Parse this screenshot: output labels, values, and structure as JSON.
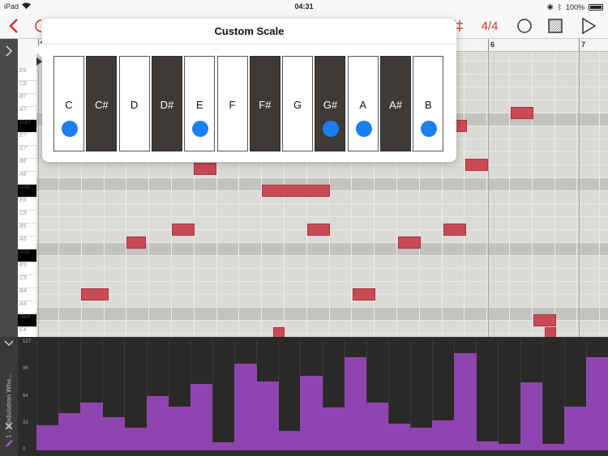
{
  "status": {
    "device": "iPad",
    "time": "04:31",
    "battery": "100%"
  },
  "toolbar": {
    "time_signature": "4/4",
    "accent_color": "#c8372d"
  },
  "ruler": {
    "visible_bars": [
      "1",
      "6",
      "7"
    ]
  },
  "keyboard": {
    "labels": [
      "E8",
      "C8",
      "B7",
      "A7",
      "G#7",
      "E7",
      "C7",
      "B6",
      "A6",
      "G#6",
      "E6",
      "C6",
      "B5",
      "A5",
      "G#5",
      "E5",
      "C5",
      "B4",
      "A4",
      "G#4",
      "E4"
    ]
  },
  "popover": {
    "title": "Custom Scale",
    "keys": [
      {
        "label": "C",
        "type": "white",
        "selected": true
      },
      {
        "label": "C#",
        "type": "black",
        "selected": false
      },
      {
        "label": "D",
        "type": "white",
        "selected": false
      },
      {
        "label": "D#",
        "type": "black",
        "selected": false
      },
      {
        "label": "E",
        "type": "white",
        "selected": true
      },
      {
        "label": "F",
        "type": "white",
        "selected": false
      },
      {
        "label": "F#",
        "type": "black",
        "selected": false
      },
      {
        "label": "G",
        "type": "white",
        "selected": false
      },
      {
        "label": "G#",
        "type": "black",
        "selected": true
      },
      {
        "label": "A",
        "type": "white",
        "selected": true
      },
      {
        "label": "A#",
        "type": "black",
        "selected": false
      },
      {
        "label": "B",
        "type": "white",
        "selected": true
      }
    ],
    "selected_color": "#1a7ff0"
  },
  "automation": {
    "label": "1 - Modulation Whe...",
    "scale": [
      "127",
      "96",
      "64",
      "32",
      "0"
    ],
    "values": [
      30,
      45,
      58,
      40,
      27,
      65,
      53,
      80,
      10,
      105,
      83,
      23,
      90,
      52,
      112,
      58,
      32,
      27,
      36,
      117,
      11,
      8,
      82,
      8,
      53,
      112
    ],
    "bar_color": "#8f45b0"
  },
  "note_color": "#c94a55"
}
